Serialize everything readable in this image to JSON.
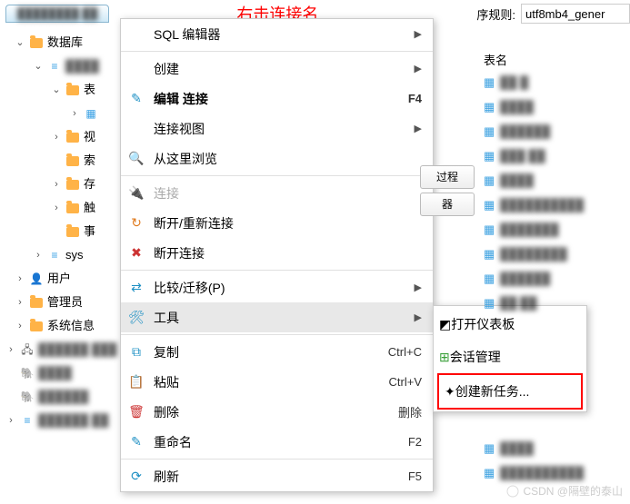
{
  "annotation": "右击连接名",
  "top_right": {
    "label": "序规则:",
    "value": "utf8mb4_gener"
  },
  "tree": {
    "database": "数据库",
    "table": "表",
    "view": "视",
    "index": "索",
    "proc": "存",
    "trigger": "触",
    "event": "事",
    "sys": "sys",
    "user": "用户",
    "admin": "管理员",
    "sysinfo": "系统信息"
  },
  "menu": {
    "sql_editor": "SQL 编辑器",
    "create": "创建",
    "edit_conn": "编辑 连接",
    "edit_conn_key": "F4",
    "conn_view": "连接视图",
    "browse": "从这里浏览",
    "connect": "连接",
    "reconnect": "断开/重新连接",
    "disconnect": "断开连接",
    "compare": "比较/迁移(P)",
    "tools": "工具",
    "copy": "复制",
    "copy_key": "Ctrl+C",
    "paste": "粘贴",
    "paste_key": "Ctrl+V",
    "delete": "删除",
    "delete_key": "删除",
    "rename": "重命名",
    "rename_key": "F2",
    "refresh": "刷新",
    "refresh_key": "F5"
  },
  "submenu": {
    "dashboard": "打开仪表板",
    "session": "会话管理",
    "new_task": "创建新任务..."
  },
  "right": {
    "table_header": "表名",
    "btn_proc": "过程",
    "btn_trig": "器"
  },
  "watermark": "CSDN @隔壁的泰山"
}
